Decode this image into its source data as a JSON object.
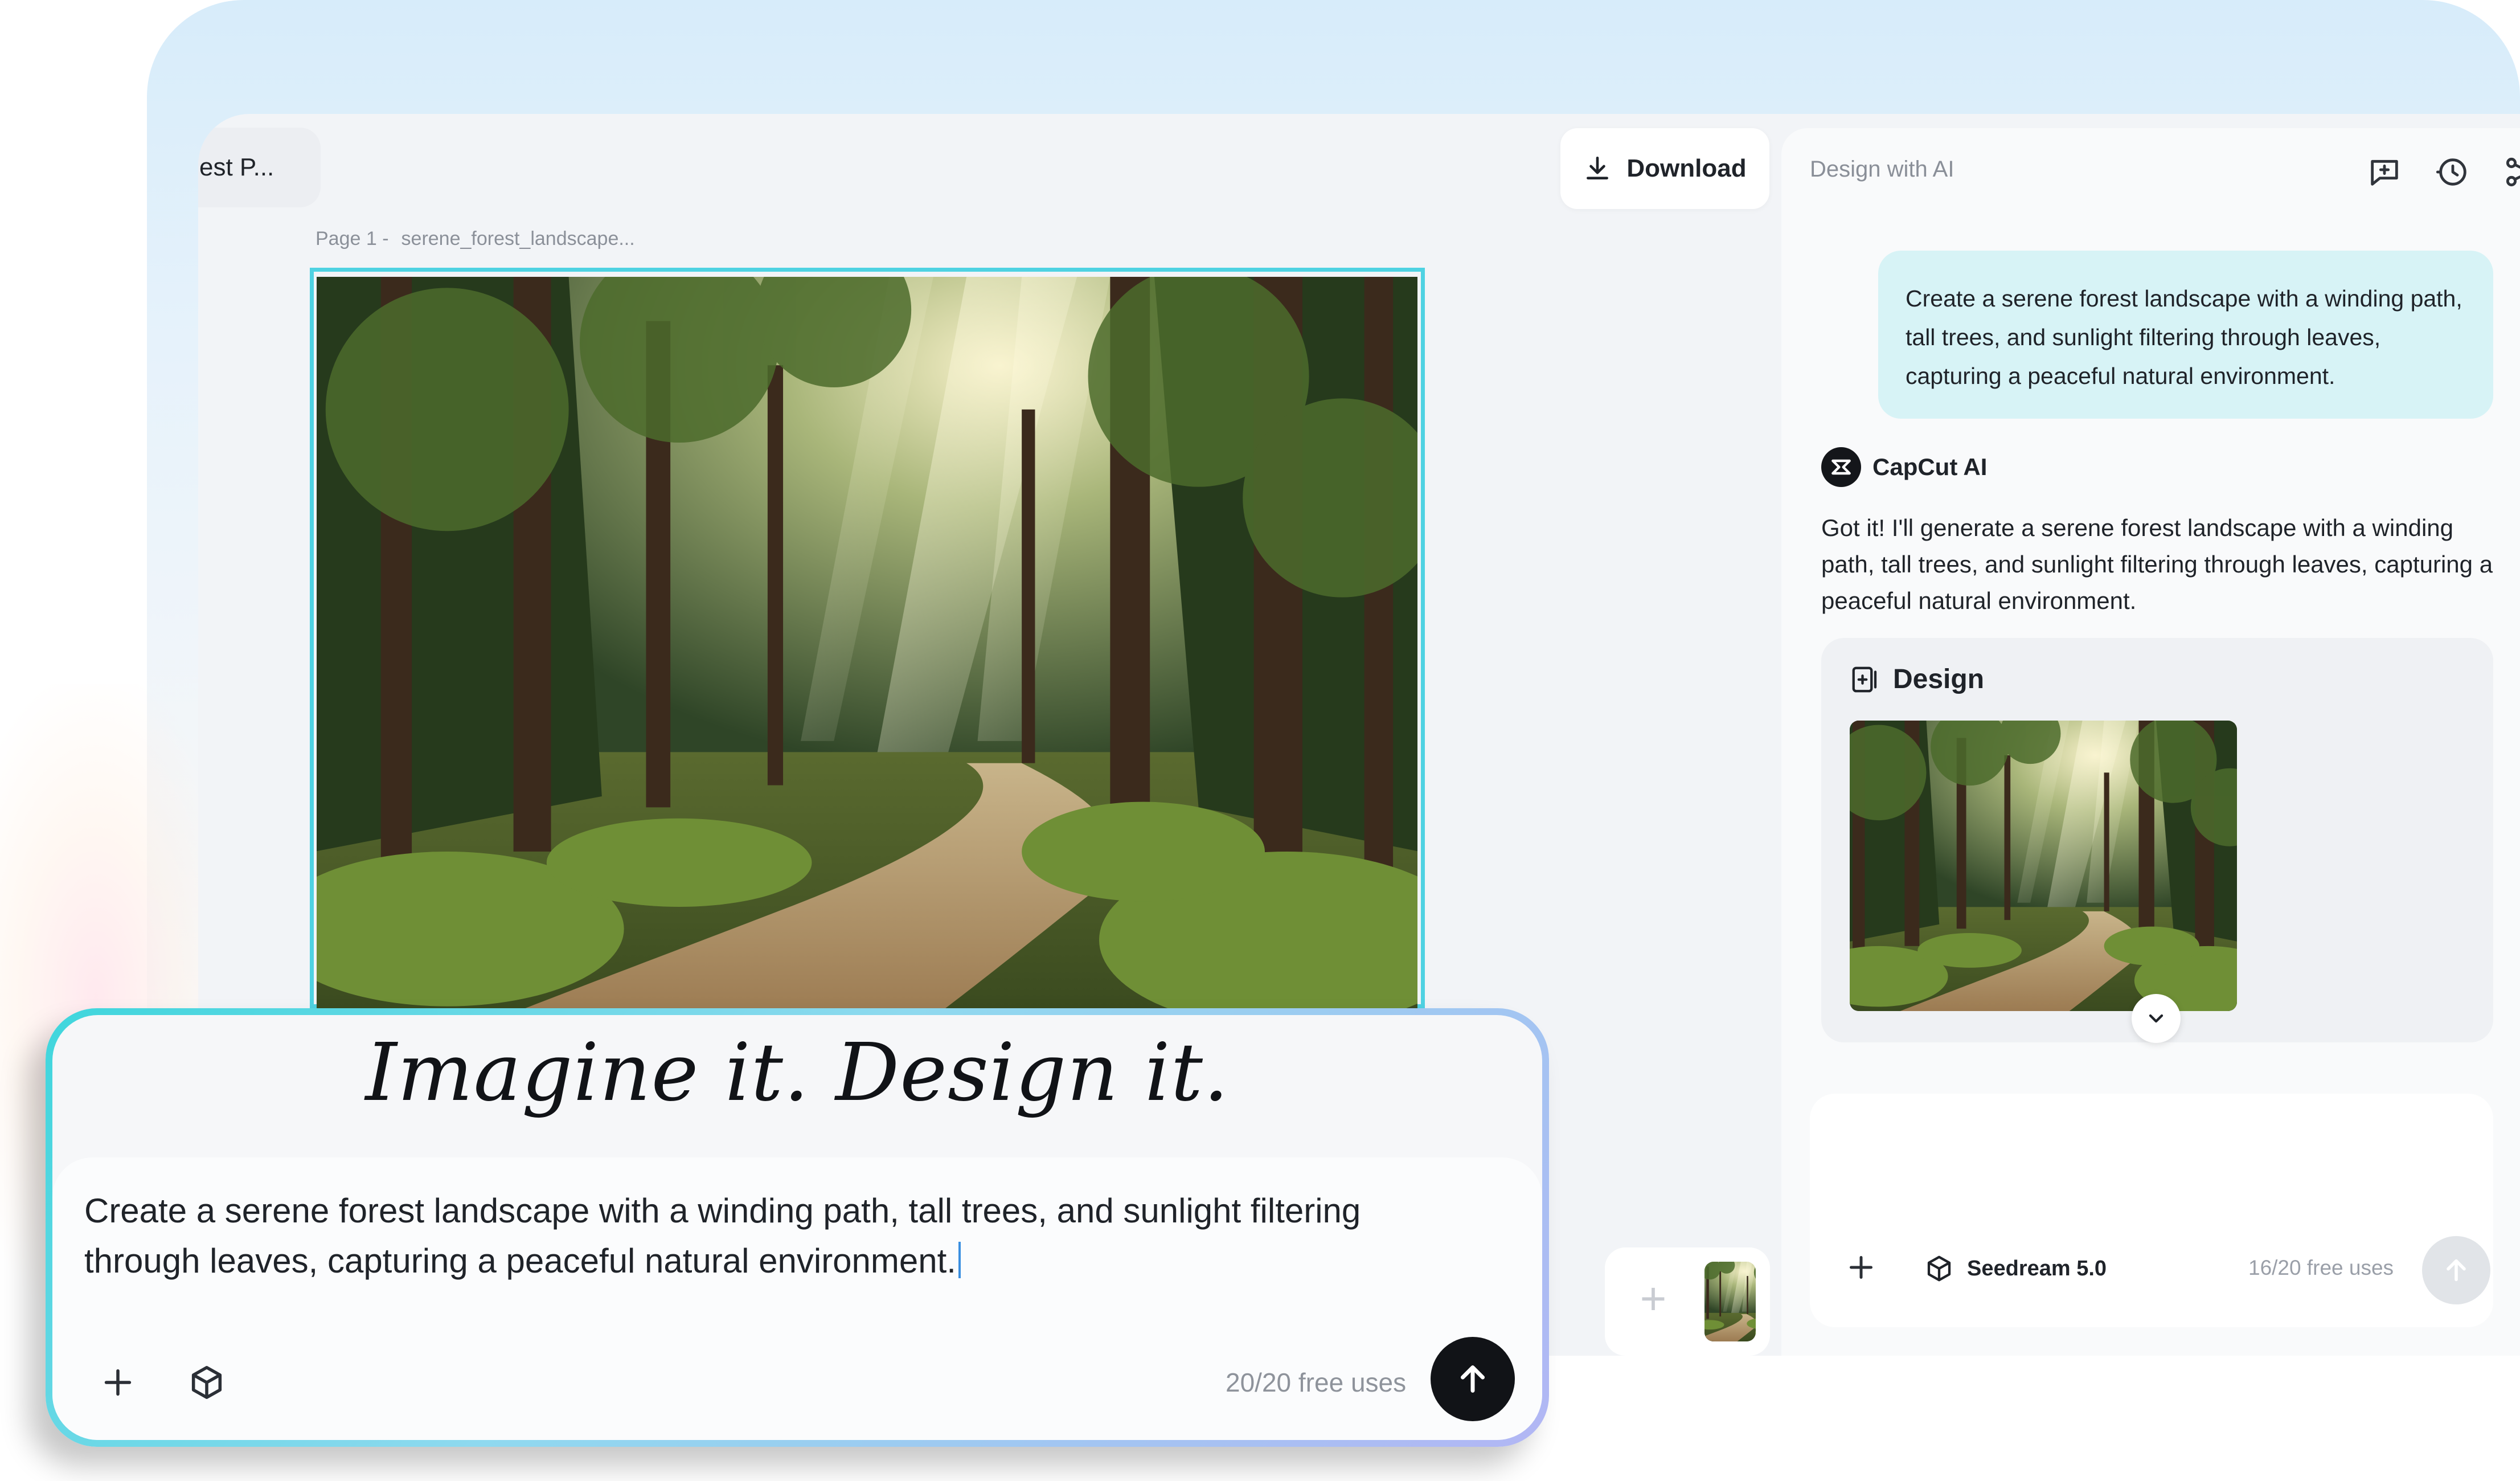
{
  "header": {
    "doc_title": "est P...",
    "download_label": "Download"
  },
  "canvas": {
    "page_prefix": "Page 1 -",
    "page_name": "serene_forest_landscape..."
  },
  "panel": {
    "title": "Design with AI",
    "tools": [
      "add-chat-icon",
      "history-icon",
      "share-icon",
      "collapse-icon"
    ],
    "user_message": "Create a serene forest landscape with a winding path, tall trees, and sunlight filtering through leaves, capturing a peaceful natural environment.",
    "ai_name": "CapCut AI",
    "ai_message": "Got it! I'll generate a serene forest landscape with a winding path, tall trees, and sunlight filtering through leaves, capturing a peaceful natural environment.",
    "design_label": "Design",
    "input": {
      "model": "Seedream 5.0",
      "uses": "16/20 free uses"
    }
  },
  "composer": {
    "tagline": "Imagine it. Design it.",
    "prompt": "Create a serene forest landscape with a winding path, tall trees, and sunlight filtering through leaves, capturing a peaceful natural environment.",
    "uses": "20/20 free uses"
  },
  "colors": {
    "accent_cyan": "#4fd2e2",
    "user_bubble": "#d7f3f6",
    "send_dark": "#111317"
  }
}
